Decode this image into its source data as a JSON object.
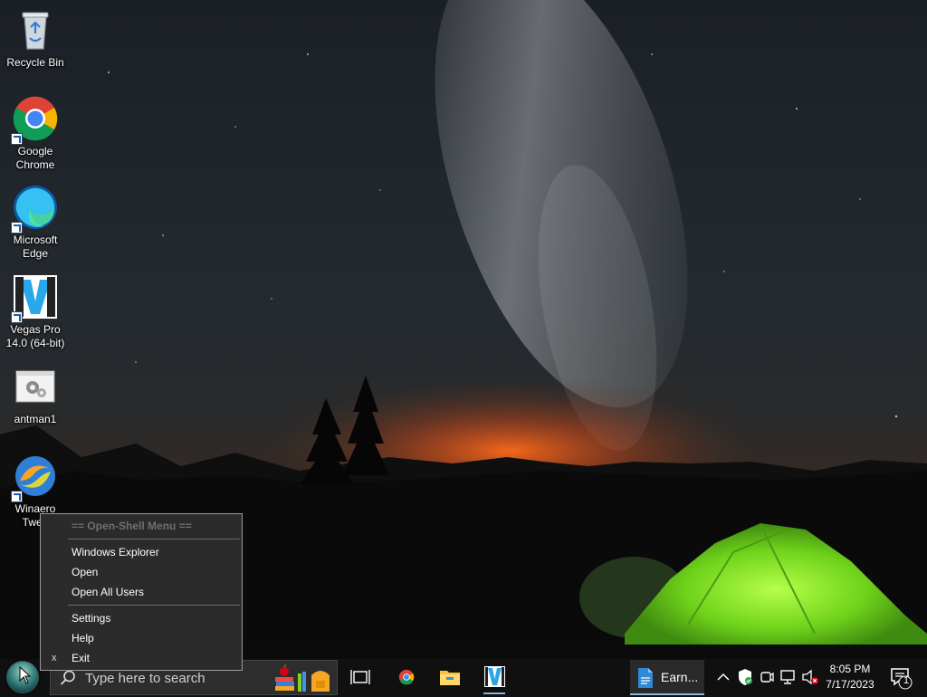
{
  "desktop": {
    "icons": [
      {
        "label": "Recycle Bin"
      },
      {
        "label": "Google Chrome"
      },
      {
        "label": "Microsoft Edge"
      },
      {
        "label": "Vegas Pro 14.0 (64-bit)"
      },
      {
        "label": "antman1"
      },
      {
        "label": "Winaero Twea"
      }
    ]
  },
  "context_menu": {
    "header": "== Open-Shell Menu ==",
    "items": [
      {
        "label": "Windows Explorer"
      },
      {
        "label": "Open"
      },
      {
        "label": "Open All Users"
      },
      {
        "label": "Settings"
      },
      {
        "label": "Help"
      },
      {
        "label": "Exit",
        "mark": "x"
      }
    ]
  },
  "taskbar": {
    "search_placeholder": "Type here to search",
    "running_app_label": "Earn...",
    "clock_time": "8:05 PM",
    "clock_date": "7/17/2023",
    "notification_count": "1",
    "icons": [
      "open-shell-start-icon",
      "search-icon",
      "task-view-icon",
      "chrome-icon",
      "file-explorer-icon",
      "vegas-pro-icon",
      "document-icon",
      "chevron-up-icon",
      "security-shield-icon",
      "meet-now-icon",
      "network-icon",
      "volume-muted-icon",
      "action-center-icon"
    ]
  },
  "colors": {
    "taskbar_bg": "#101010",
    "menu_bg": "#2b2b2b",
    "accent": "#8ab4e0",
    "tent_green": "#7ed321"
  }
}
